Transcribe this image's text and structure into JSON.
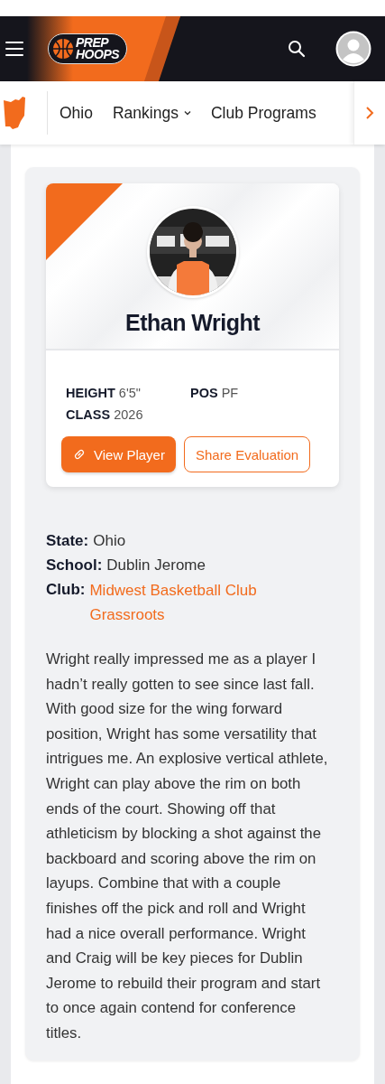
{
  "header": {
    "logo_lines": [
      "PREP",
      "HOOPS"
    ]
  },
  "nav": {
    "items": [
      {
        "label": "Ohio",
        "kind": "link"
      },
      {
        "label": "Rankings",
        "kind": "dropdown"
      },
      {
        "label": "Club Programs",
        "kind": "link"
      }
    ]
  },
  "player": {
    "name": "Ethan Wright",
    "stats": [
      {
        "label": "HEIGHT",
        "value": "6'5\""
      },
      {
        "label": "POS",
        "value": "PF"
      },
      {
        "label": "CLASS",
        "value": "2026"
      }
    ],
    "buttons": [
      {
        "label": "View Player",
        "kind": "primary"
      },
      {
        "label": "Share Evaluation",
        "kind": "outline"
      }
    ]
  },
  "details": [
    {
      "label": "State:",
      "value": "Ohio",
      "kind": "text"
    },
    {
      "label": "School:",
      "value": "Dublin Jerome",
      "kind": "text"
    },
    {
      "label": "Club:",
      "value": "Midwest Basketball Club Grassroots",
      "kind": "link"
    }
  ],
  "evaluation": "Wright really impressed me as a player I hadn’t really gotten to see since last fall. With good size for the wing forward position, Wright has some versatility that intrigues me. An explosive vertical athlete, Wright can play above the rim on both ends of the court. Showing off that athleticism by blocking a shot against the backboard and scoring above the rim on layups. Combine that with a couple finishes off the pick and roll and Wright had a nice overall performance. Wright and Craig will be key pieces for Dublin Jerome to rebuild their program and start to once again contend for conference titles."
}
